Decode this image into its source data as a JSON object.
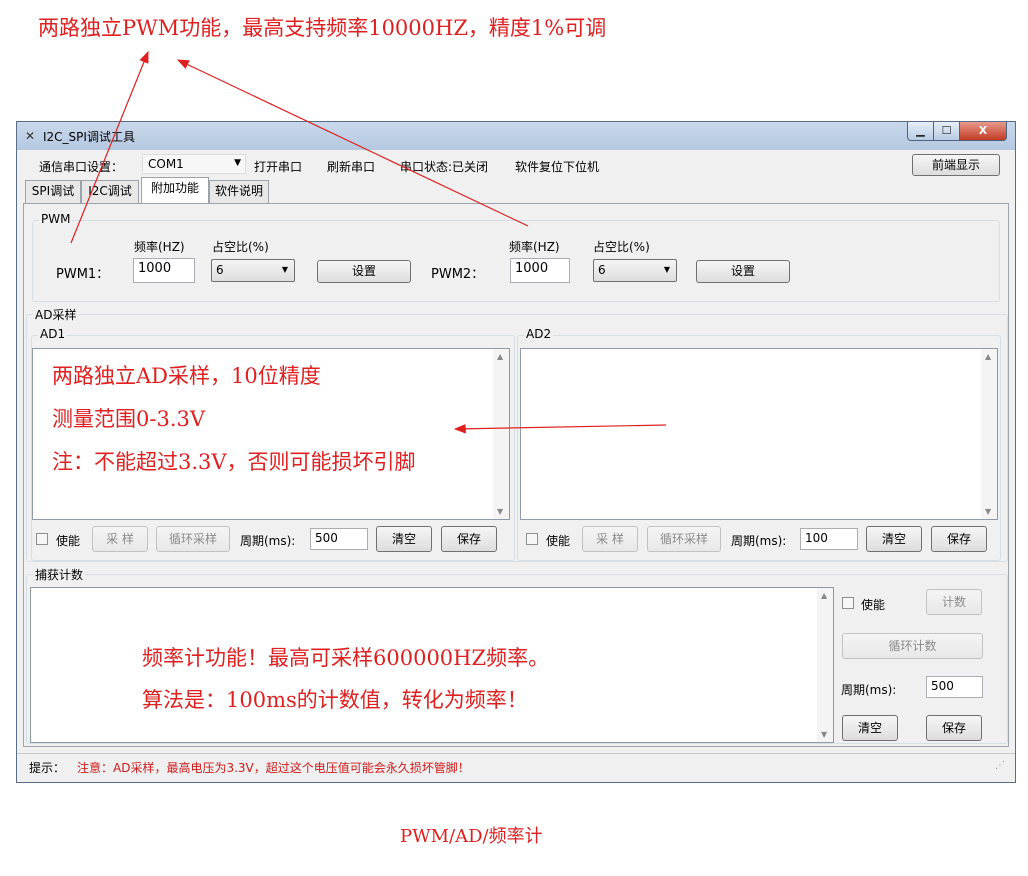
{
  "annotations": {
    "top": "两路独立PWM功能，最高支持频率10000HZ，精度1%可调",
    "ad_line1": "两路独立AD采样，10位精度",
    "ad_line2": "测量范围0-3.3V",
    "ad_line3": "注：不能超过3.3V，否则可能损坏引脚",
    "count_line1": "频率计功能！最高可采样600000HZ频率。",
    "count_line2": "算法是：100ms的计数值，转化为频率！",
    "caption": "PWM/AD/频率计"
  },
  "window": {
    "title": "I2C_SPI调试工具",
    "min_glyph": "▁",
    "max_glyph": "☐",
    "close_glyph": "X",
    "app_icon": "✕"
  },
  "toolbar": {
    "serial_label": "通信串口设置：",
    "com_value": "COM1",
    "open_port": "打开串口",
    "refresh_port": "刷新串口",
    "port_status": "串口状态:已关闭",
    "reset": "软件复位下位机",
    "front_display": "前端显示"
  },
  "tabs": [
    "SPI调试",
    "I2C调试",
    "附加功能",
    "软件说明"
  ],
  "pwm": {
    "group_title": "PWM",
    "pwm1_label": "PWM1：",
    "pwm2_label": "PWM2：",
    "freq_label": "频率(HZ)",
    "duty_label": "占空比(%)",
    "pwm1_freq": "1000",
    "pwm1_duty": "6",
    "pwm2_freq": "1000",
    "pwm2_duty": "6",
    "set_button": "设置"
  },
  "ad": {
    "group_title": "AD采样",
    "ad1_title": "AD1",
    "ad2_title": "AD2",
    "enable_label": "使能",
    "sample_button": "采 样",
    "loop_sample_button": "循环采样",
    "period_label": "周期(ms):",
    "ad1_period": "500",
    "ad2_period": "100",
    "clear_button": "清空",
    "save_button": "保存"
  },
  "capture": {
    "group_title": "捕获计数",
    "enable_label": "使能",
    "count_button": "计数",
    "loop_count_button": "循环计数",
    "period_label": "周期(ms):",
    "period_value": "500",
    "clear_button": "清空",
    "save_button": "保存"
  },
  "status": {
    "prefix": "提示：",
    "message": "注意：AD采样，最高电压为3.3V，超过这个电压值可能会永久损坏管脚！"
  },
  "colors": {
    "annotation": "#e02020",
    "titlebar": "#b4c8e0",
    "window_bg": "#f0f0f0"
  }
}
